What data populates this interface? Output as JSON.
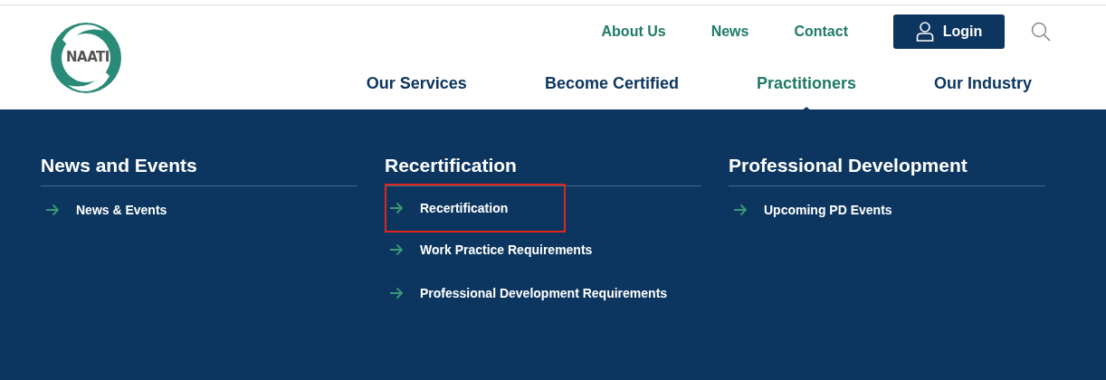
{
  "logo": {
    "text": "NAATI"
  },
  "top_links": [
    "About Us",
    "News",
    "Contact"
  ],
  "login_button": {
    "label": "Login"
  },
  "main_nav": [
    {
      "label": "Our Services",
      "selected": false
    },
    {
      "label": "Become Certified",
      "selected": false
    },
    {
      "label": "Practitioners",
      "selected": true
    },
    {
      "label": "Our Industry",
      "selected": false
    }
  ],
  "menu_columns": [
    {
      "heading": "News and Events",
      "items": [
        {
          "label": "News & Events",
          "highlighted": false
        }
      ]
    },
    {
      "heading": "Recertification",
      "items": [
        {
          "label": "Recertification",
          "highlighted": true
        },
        {
          "label": "Work Practice Requirements",
          "highlighted": false
        },
        {
          "label": "Professional Development Requirements",
          "highlighted": false
        }
      ]
    },
    {
      "heading": "Professional Development",
      "items": [
        {
          "label": "Upcoming PD Events",
          "highlighted": false
        }
      ]
    }
  ]
}
